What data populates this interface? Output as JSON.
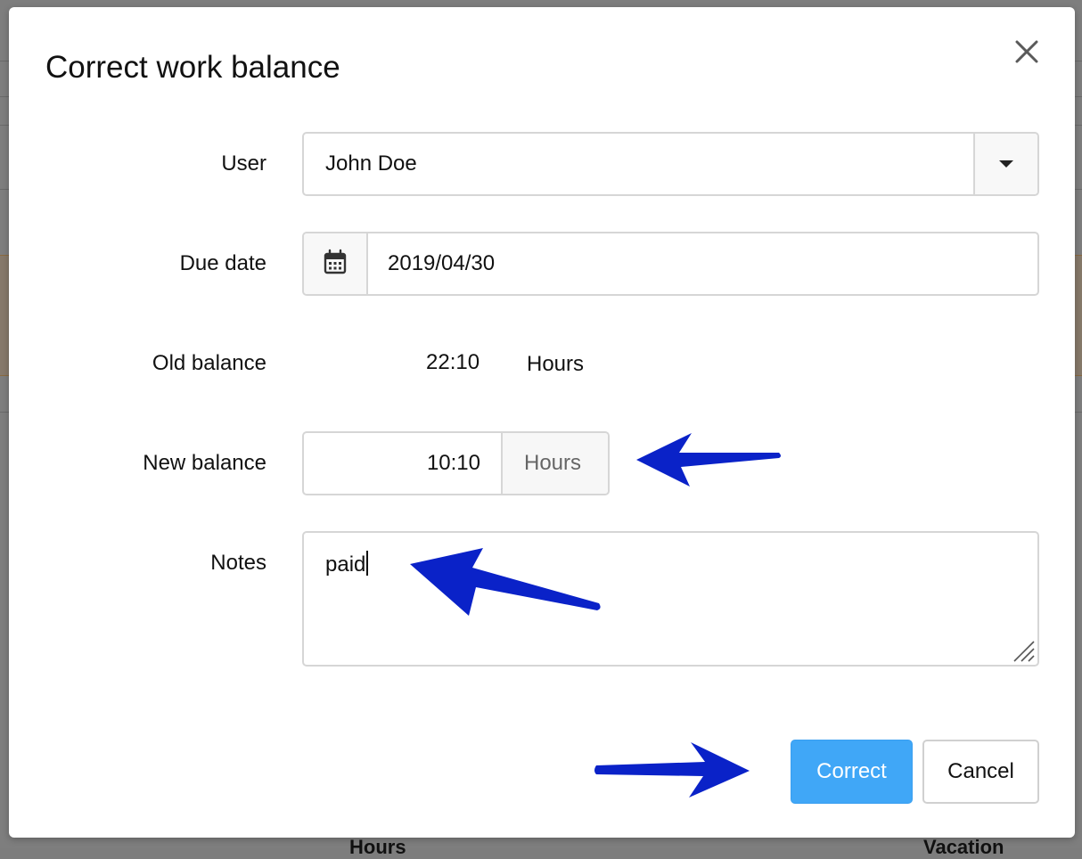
{
  "background": {
    "footer_left": "Hours",
    "footer_right": "Vacation"
  },
  "dialog": {
    "title": "Correct work balance",
    "close_icon": "close-icon",
    "user": {
      "label": "User",
      "value": "John Doe",
      "icon": "chevron-down-icon"
    },
    "due_date": {
      "label": "Due date",
      "value": "2019/04/30",
      "icon": "calendar-icon"
    },
    "old_balance": {
      "label": "Old balance",
      "value": "22:10",
      "unit": "Hours"
    },
    "new_balance": {
      "label": "New balance",
      "value": "10:10",
      "unit": "Hours"
    },
    "notes": {
      "label": "Notes",
      "value": "paid"
    },
    "buttons": {
      "primary": "Correct",
      "secondary": "Cancel"
    }
  },
  "colors": {
    "primary_button": "#40a7f7",
    "annotation_arrow": "#0a22c8",
    "overlay": "#7e7e7e"
  }
}
